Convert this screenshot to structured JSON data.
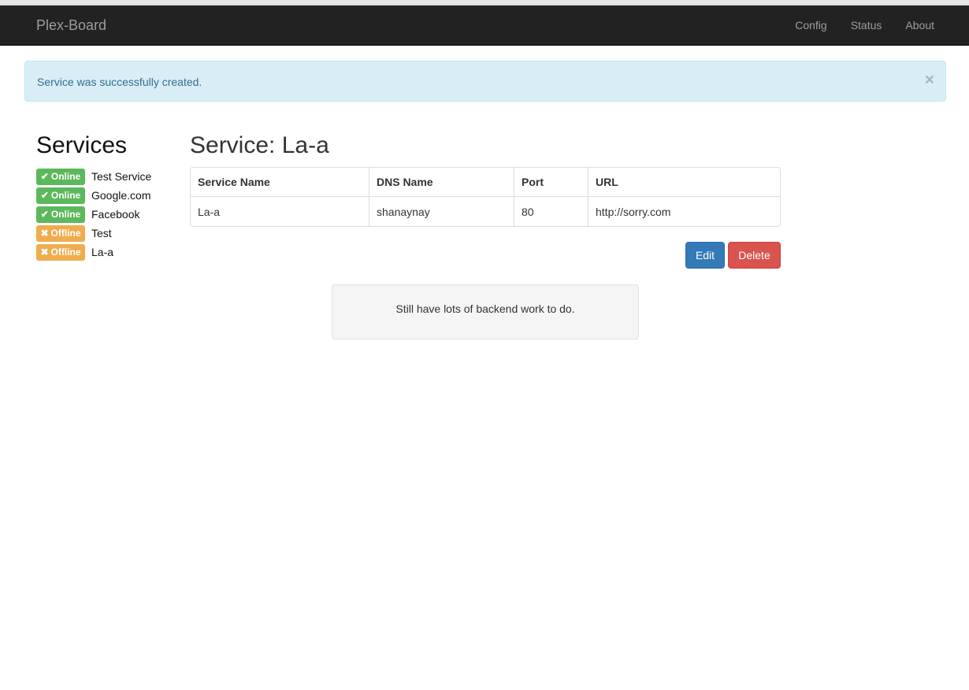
{
  "navbar": {
    "brand": "Plex-Board",
    "links": [
      "Config",
      "Status",
      "About"
    ]
  },
  "alert": {
    "message": "Service was successfully created.",
    "close": "×"
  },
  "sidebar": {
    "title": "Services",
    "items": [
      {
        "status": "Online",
        "icon": "check-icon",
        "name": "Test Service"
      },
      {
        "status": "Online",
        "icon": "check-icon",
        "name": "Google.com"
      },
      {
        "status": "Online",
        "icon": "check-icon",
        "name": "Facebook"
      },
      {
        "status": "Offline",
        "icon": "x-icon",
        "name": "Test"
      },
      {
        "status": "Offline",
        "icon": "x-icon",
        "name": "La-a"
      }
    ]
  },
  "main": {
    "title": "Service: La-a",
    "table": {
      "headers": [
        "Service Name",
        "DNS Name",
        "Port",
        "URL"
      ],
      "row": [
        "La-a",
        "shanaynay",
        "80",
        "http://sorry.com"
      ]
    },
    "edit_label": "Edit",
    "delete_label": "Delete",
    "note": "Still have lots of backend work to do."
  },
  "colors": {
    "navbar": "#222222",
    "online": "#5cb85c",
    "offline": "#f0ad4e",
    "primary": "#337ab7",
    "danger": "#d9534f",
    "info_bg": "#d9edf7"
  }
}
